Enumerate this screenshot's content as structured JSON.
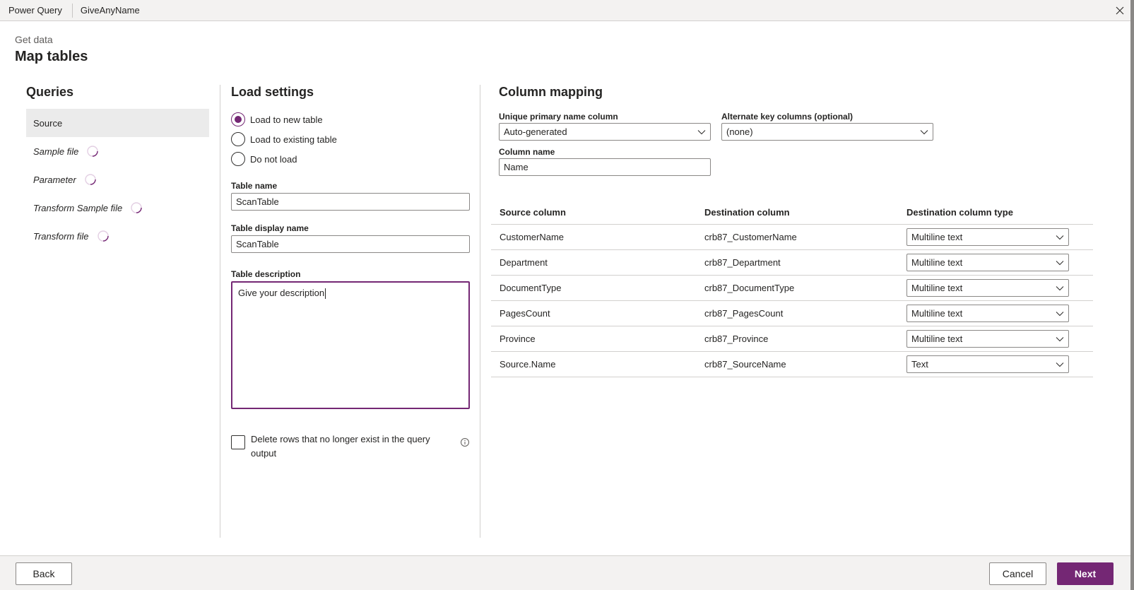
{
  "topbar": {
    "app_name": "Power Query",
    "document_name": "GiveAnyName",
    "close_icon": "close-icon"
  },
  "header": {
    "breadcrumb": "Get data",
    "title": "Map tables"
  },
  "queries": {
    "heading": "Queries",
    "items": [
      {
        "label": "Source",
        "selected": true,
        "loading": false
      },
      {
        "label": "Sample file",
        "selected": false,
        "loading": true
      },
      {
        "label": "Parameter",
        "selected": false,
        "loading": true
      },
      {
        "label": "Transform Sample file",
        "selected": false,
        "loading": true
      },
      {
        "label": "Transform file",
        "selected": false,
        "loading": true
      }
    ]
  },
  "load_settings": {
    "heading": "Load settings",
    "options": [
      {
        "label": "Load to new table",
        "selected": true
      },
      {
        "label": "Load to existing table",
        "selected": false
      },
      {
        "label": "Do not load",
        "selected": false
      }
    ],
    "table_name_label": "Table name",
    "table_name_value": "ScanTable",
    "display_name_label": "Table display name",
    "display_name_value": "ScanTable",
    "description_label": "Table description",
    "description_value": "Give your description",
    "delete_rows_label": "Delete rows that no longer exist in the query output",
    "delete_rows_checked": false
  },
  "column_mapping": {
    "heading": "Column mapping",
    "primary_label": "Unique primary name column",
    "primary_value": "Auto-generated",
    "alternate_label": "Alternate key columns (optional)",
    "alternate_value": "(none)",
    "column_name_label": "Column name",
    "column_name_value": "Name",
    "table": {
      "headers": [
        "Source column",
        "Destination column",
        "Destination column type"
      ],
      "rows": [
        {
          "source": "CustomerName",
          "destination": "crb87_CustomerName",
          "type": "Multiline text"
        },
        {
          "source": "Department",
          "destination": "crb87_Department",
          "type": "Multiline text"
        },
        {
          "source": "DocumentType",
          "destination": "crb87_DocumentType",
          "type": "Multiline text"
        },
        {
          "source": "PagesCount",
          "destination": "crb87_PagesCount",
          "type": "Multiline text"
        },
        {
          "source": "Province",
          "destination": "crb87_Province",
          "type": "Multiline text"
        },
        {
          "source": "Source.Name",
          "destination": "crb87_SourceName",
          "type": "Text"
        }
      ]
    }
  },
  "footer": {
    "back_label": "Back",
    "cancel_label": "Cancel",
    "next_label": "Next"
  },
  "colors": {
    "accent": "#742774",
    "selected_bg": "#ebebeb",
    "chrome_bg": "#f3f2f1"
  }
}
